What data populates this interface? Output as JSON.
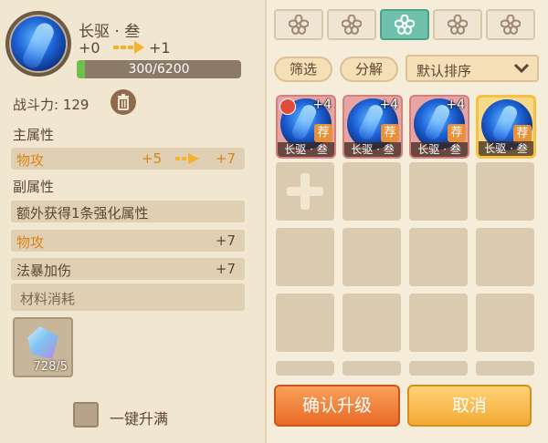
{
  "equipment": {
    "name": "长驱 · 叁",
    "level_from": "+0",
    "level_to": "+1",
    "xp_text": "300/6200",
    "xp_progress": 0.048
  },
  "combat_power": {
    "label": "战斗力: 129"
  },
  "main_attr": {
    "title": "主属性",
    "stat": {
      "name": "物攻",
      "from": "+5",
      "to": "+7"
    }
  },
  "sub_attr": {
    "title": "副属性",
    "rows": [
      {
        "name": "额外获得1条强化属性",
        "value": ""
      },
      {
        "name": "物攻",
        "value": "+7"
      },
      {
        "name": "法暴加伤",
        "value": "+7"
      }
    ]
  },
  "materials": {
    "title": "材料消耗",
    "count": "728/5"
  },
  "one_click": {
    "label": "一键升满",
    "checked": false
  },
  "filters": {
    "tab_icons": [
      "flower-icon",
      "flower-icon",
      "flower-icon",
      "flower-icon",
      "flower-icon"
    ],
    "active_index": 2,
    "screen_label": "筛选",
    "decompose_label": "分解",
    "sort_label": "默认排序"
  },
  "items": [
    {
      "name": "长驱 · 叁",
      "plus": "+4",
      "badge": true,
      "recommended": true,
      "selected": false
    },
    {
      "name": "长驱 · 叁",
      "plus": "+4",
      "badge": false,
      "recommended": true,
      "selected": false
    },
    {
      "name": "长驱 · 叁",
      "plus": "+4",
      "badge": false,
      "recommended": true,
      "selected": false
    },
    {
      "name": "长驱 · 叁",
      "plus": "",
      "badge": false,
      "recommended": true,
      "selected": true
    }
  ],
  "recommend_tag": "荐",
  "actions": {
    "confirm_label": "确认升级",
    "cancel_label": "取消"
  },
  "colors": {
    "background": "#f1e6cf",
    "stat_highlight": "#d98417",
    "xp_fill": "#6ec24a",
    "active_tab": "#6fc1ab",
    "confirm": "#e86a26",
    "cancel": "#f2aa33"
  }
}
